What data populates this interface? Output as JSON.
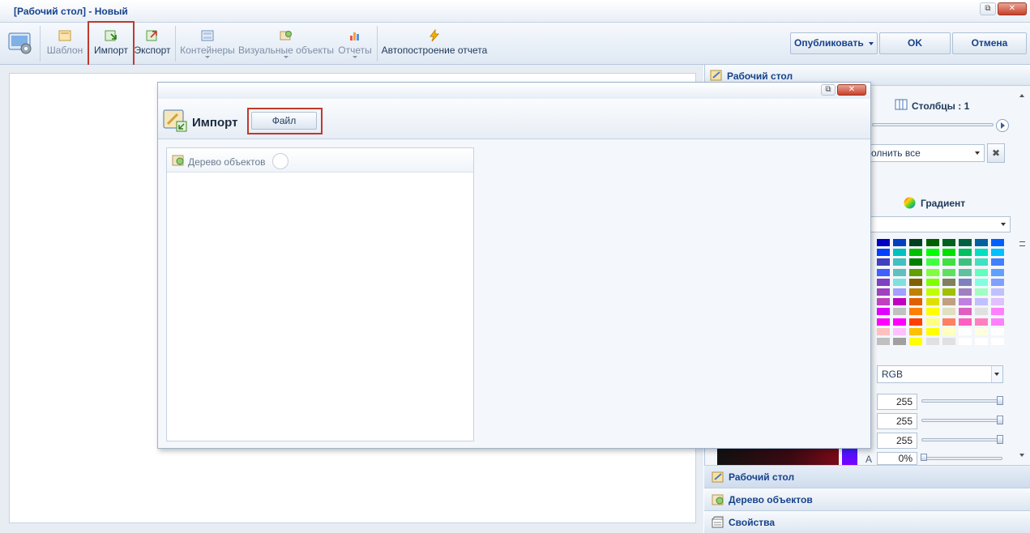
{
  "window": {
    "title": "[Рабочий стол] - Новый",
    "restore_glyph": "⧉",
    "close_glyph": "✕"
  },
  "ribbon": {
    "items": [
      {
        "label": "Шаблон",
        "icon": "template-icon"
      },
      {
        "label": "Импорт",
        "icon": "import-icon"
      },
      {
        "label": "Экспорт",
        "icon": "export-icon"
      },
      {
        "label": "Контейнеры",
        "icon": "containers-icon"
      },
      {
        "label": "Визуальные объекты",
        "icon": "visual-objects-icon"
      },
      {
        "label": "Отчеты",
        "icon": "reports-icon"
      },
      {
        "label": "Автопостроение отчета",
        "icon": "lightning-icon"
      }
    ],
    "publish_label": "Опубликовать",
    "ok_label": "OK",
    "cancel_label": "Отмена"
  },
  "right_panel": {
    "header": "Рабочий стол",
    "columns_label": "Столбцы : 1",
    "fill_combo": "олнить все",
    "gradient_label": "Градиент",
    "color_model": "RGB",
    "r_value": "255",
    "g_value": "255",
    "b_value": "255",
    "alpha_label": "A",
    "alpha_value": "0%",
    "accordion": [
      {
        "label": "Рабочий стол",
        "icon": "desktop-icon"
      },
      {
        "label": "Дерево объектов",
        "icon": "object-tree-icon"
      },
      {
        "label": "Свойства",
        "icon": "properties-icon"
      }
    ]
  },
  "dialog": {
    "title": "Импорт",
    "file_button": "Файл",
    "tree_header": "Дерево объектов",
    "restore_glyph": "⧉",
    "close_glyph": "✕"
  },
  "colors": {
    "accent": "#15428b",
    "highlight_border": "#c0392b",
    "close_red": "#c7402a"
  }
}
